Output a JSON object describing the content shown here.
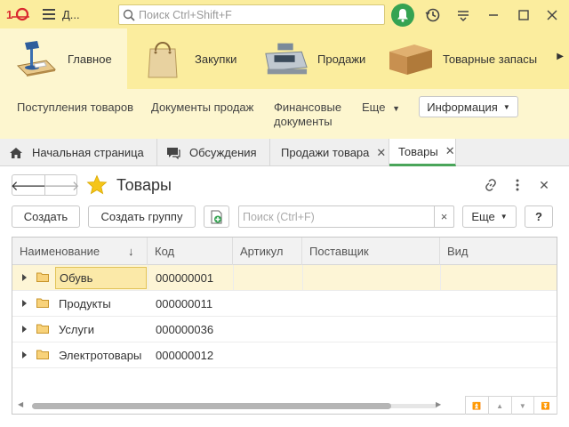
{
  "titlebar": {
    "app_title": "Д...",
    "search_placeholder": "Поиск Ctrl+Shift+F"
  },
  "sections": [
    {
      "label": "Главное",
      "icon": "desk-lamp-icon",
      "active": true
    },
    {
      "label": "Закупки",
      "icon": "shopping-bag-icon",
      "active": false
    },
    {
      "label": "Продажи",
      "icon": "cash-register-icon",
      "active": false
    },
    {
      "label": "Товарные запасы",
      "icon": "cardboard-box-icon",
      "active": false
    }
  ],
  "commands": {
    "receipts": "Поступления товаров",
    "sales_docs": "Документы продаж",
    "finance_line1": "Финансовые",
    "finance_line2": "документы",
    "more": "Еще",
    "info": "Информация"
  },
  "tabs": [
    {
      "label": "Начальная страница",
      "icon": "home-icon"
    },
    {
      "label": "Обсуждения",
      "icon": "chat-icon"
    },
    {
      "label": "Продажи товара",
      "closable": true
    },
    {
      "label": "Товары",
      "closable": true,
      "active": true
    }
  ],
  "form": {
    "title": "Товары",
    "create": "Создать",
    "create_group": "Создать группу",
    "search_placeholder": "Поиск (Ctrl+F)",
    "search_clear": "×",
    "more": "Еще",
    "help": "?"
  },
  "table": {
    "columns": [
      "Наименование",
      "Код",
      "Артикул",
      "Поставщик",
      "Вид"
    ],
    "sort_indicator": "↓",
    "rows": [
      {
        "name": "Обувь",
        "code": "000000001",
        "selected": true
      },
      {
        "name": "Продукты",
        "code": "000000011"
      },
      {
        "name": "Услуги",
        "code": "000000036"
      },
      {
        "name": "Электротовары",
        "code": "000000012"
      }
    ]
  },
  "colors": {
    "brand_yellow": "#fbed9e",
    "light_yellow": "#fdf6cf",
    "accent_green": "#4aa55a",
    "selection": "#fbe9a8",
    "logo_red": "#d9272e"
  }
}
